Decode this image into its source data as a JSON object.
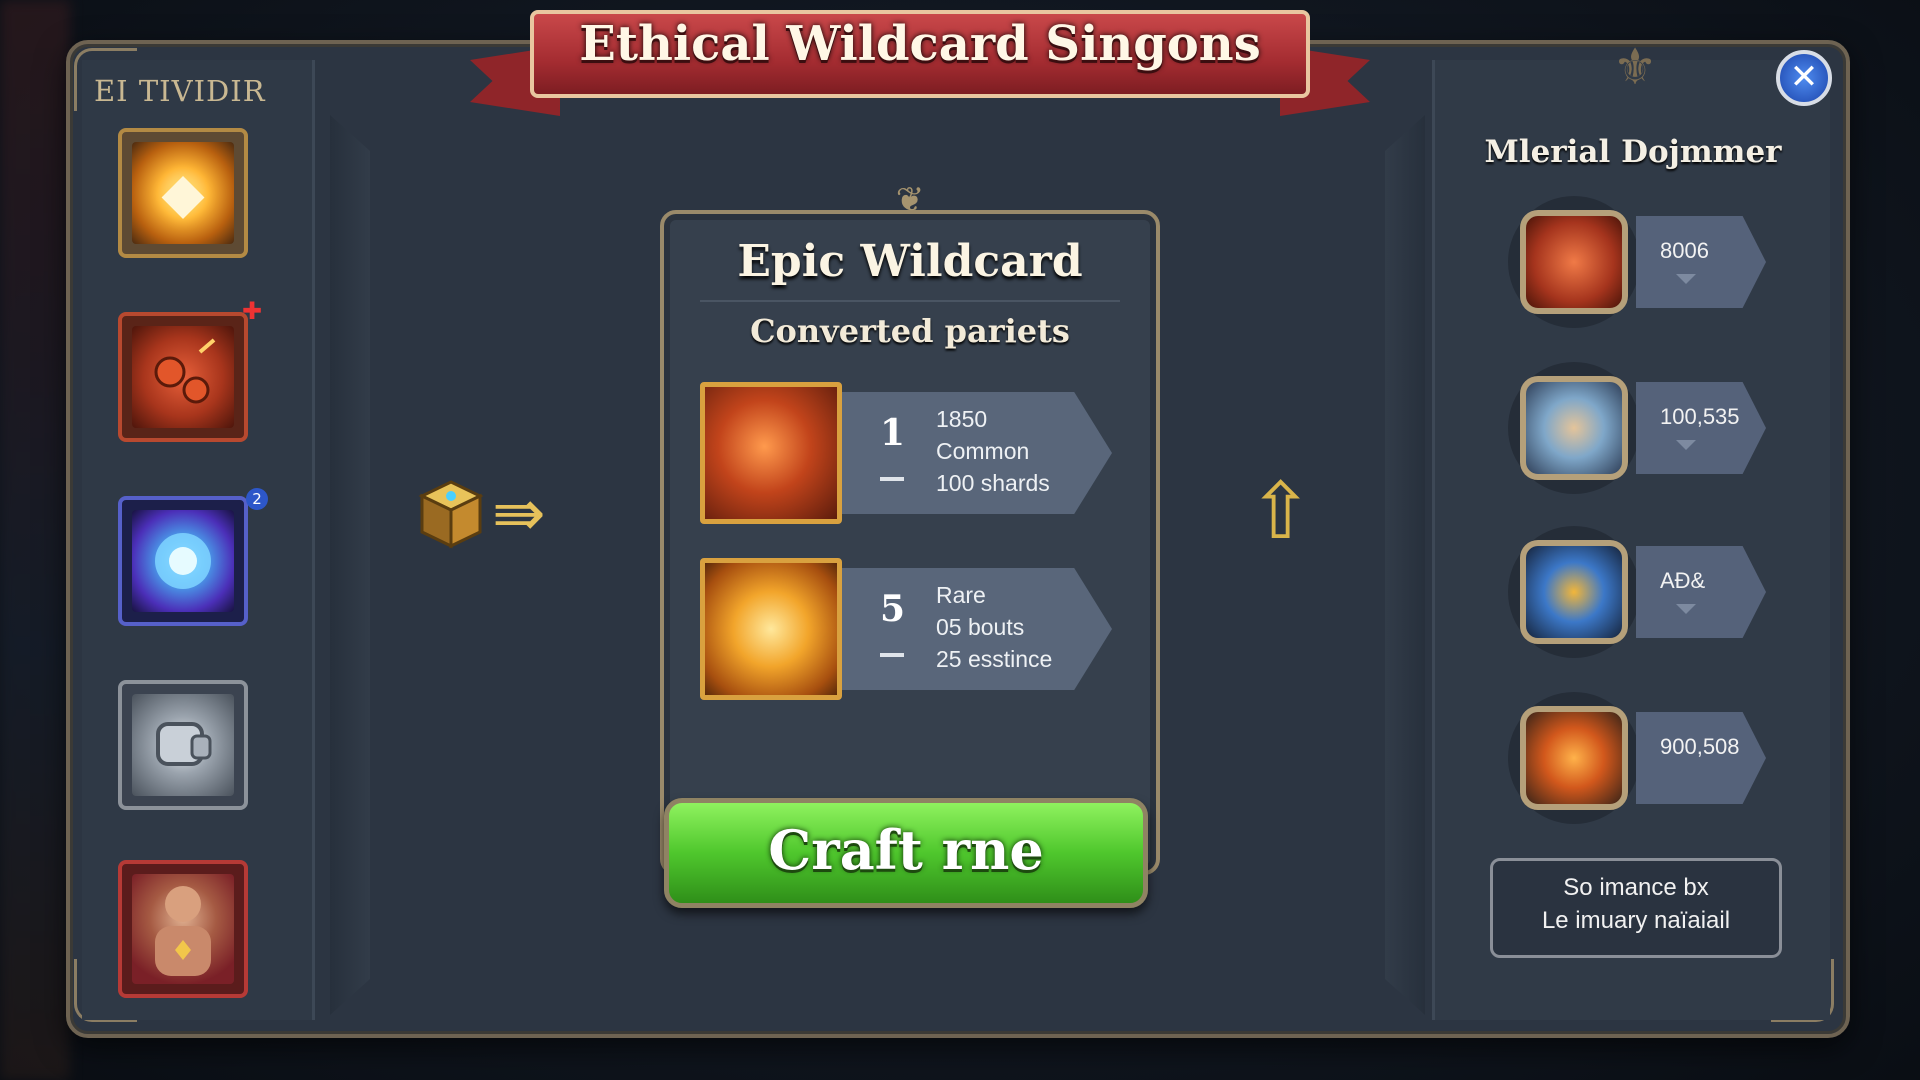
{
  "header": {
    "title": "Ethical Wildcard Singons",
    "close_label": "✕"
  },
  "left_panel": {
    "title": "EI TIVIDIR",
    "slots": [
      {
        "name": "glowing-gem",
        "badge": ""
      },
      {
        "name": "fire-orbs",
        "badge": ""
      },
      {
        "name": "arcane-orb",
        "badge": "2"
      },
      {
        "name": "iron-gauntlet",
        "badge": ""
      },
      {
        "name": "warrior-portrait",
        "badge": ""
      }
    ]
  },
  "card": {
    "title": "Epic Wildcard",
    "subtitle": "Converted pariets",
    "recipes": [
      {
        "qty": "1",
        "line1": "1850",
        "line2": "Common",
        "line3": "100 shards"
      },
      {
        "qty": "5",
        "line1": "Rare",
        "line2": "05 bouts",
        "line3": "25 esstince"
      }
    ],
    "craft_label": "Craft rne"
  },
  "materials": {
    "title": "Mlerial Dojmmer",
    "items": [
      {
        "value": "8006"
      },
      {
        "value": "100,535"
      },
      {
        "value": "AÐ&"
      },
      {
        "value": "900,508"
      }
    ],
    "info_line1": "So imance bx",
    "info_line2": "Le imuary naïaiail"
  },
  "colors": {
    "accent_green": "#4fc72d",
    "ribbon_red": "#a42c31",
    "gold_border": "#d9a13f"
  }
}
